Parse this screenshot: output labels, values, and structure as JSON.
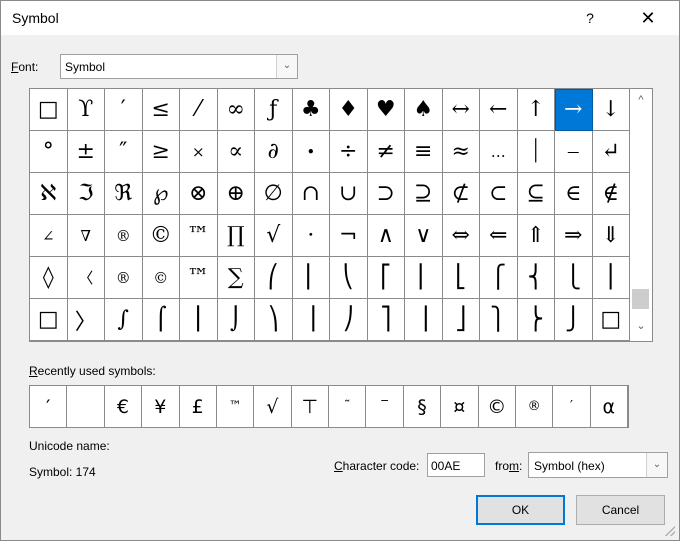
{
  "window": {
    "title": "Symbol",
    "help_label": "?",
    "close_label": "✕"
  },
  "font": {
    "label_accel": "F",
    "label_rest": "ont:",
    "value": "Symbol",
    "dropdown_icon": "chevron-down-icon"
  },
  "grid": {
    "selected_index": 14,
    "small_cells": [
      20,
      23,
      28,
      48,
      49,
      50,
      65,
      66,
      67
    ],
    "cells": [
      "□",
      "ϒ",
      "′",
      "≤",
      "⁄",
      "∞",
      "ƒ",
      "♣",
      "♦",
      "♥",
      "♠",
      "↔",
      "←",
      "↑",
      "→",
      "↓",
      "°",
      "±",
      "″",
      "≥",
      "×",
      "∝",
      "∂",
      "•",
      "÷",
      "≠",
      "≡",
      "≈",
      "…",
      "⏐",
      "⎯",
      "↵",
      "ℵ",
      "ℑ",
      "ℜ",
      "℘",
      "⊗",
      "⊕",
      "∅",
      "∩",
      "∪",
      "⊃",
      "⊇",
      "⊄",
      "⊂",
      "⊆",
      "∈",
      "∉",
      "∠",
      "∇",
      "®",
      "©",
      "™",
      "∏",
      "√",
      "⋅",
      "¬",
      "∧",
      "∨",
      "⇔",
      "⇐",
      "⇑",
      "⇒",
      "⇓",
      "◊",
      "〈",
      "®",
      "©",
      "™",
      "∑",
      "⎛",
      "⎜",
      "⎝",
      "⎡",
      "⎢",
      "⎣",
      "⎧",
      "⎨",
      "⎩",
      "⎪",
      "□",
      "〉",
      "∫",
      "⌠",
      "⎮",
      "⌡",
      "⎞",
      "⎟",
      "⎠",
      "⎤",
      "⎥",
      "⎦",
      "⎫",
      "⎬",
      "⎭",
      "□"
    ]
  },
  "scrollbar": {
    "up_label": "^",
    "down_label": "⌄"
  },
  "recent": {
    "label_accel": "R",
    "label_rest": "ecently used symbols:",
    "small_cells": [
      5,
      8,
      9,
      13,
      14
    ],
    "symbols": [
      "′",
      "",
      "€",
      "¥",
      "£",
      "™",
      "√",
      "⊤",
      "˜",
      "‾",
      "§",
      "¤",
      "©",
      "®",
      "′",
      "α"
    ]
  },
  "info": {
    "unicode_name_label": "Unicode name:",
    "symbol_code": "Symbol: 174"
  },
  "char_code": {
    "label_accel": "C",
    "label_rest": "haracter code:",
    "value": "00AE"
  },
  "from": {
    "label_pre": "fro",
    "label_accel": "m",
    "label_post": ":",
    "value": "Symbol (hex)"
  },
  "buttons": {
    "ok": "OK",
    "cancel": "Cancel"
  }
}
